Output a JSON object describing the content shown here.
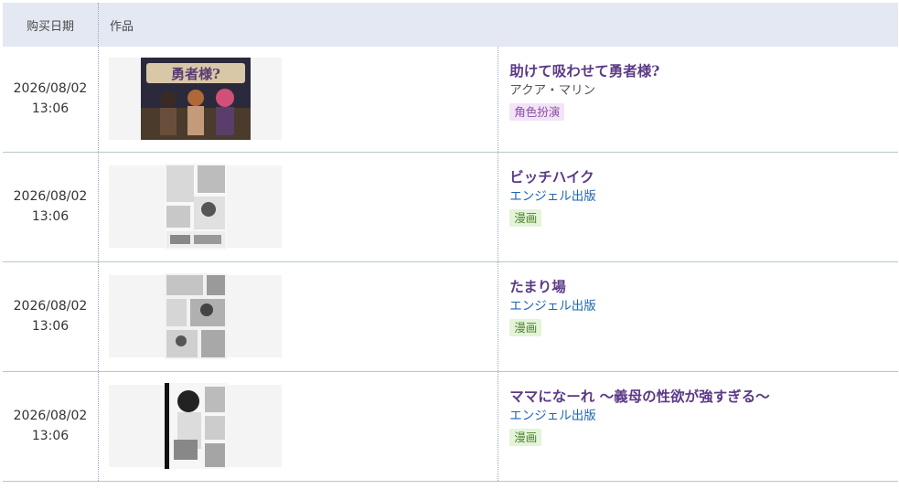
{
  "table": {
    "header": {
      "date": "购买日期",
      "work": "作品"
    },
    "rows": [
      {
        "date": "2026/08/02",
        "time": "13:06",
        "title": "助けて吸わせて勇者様?",
        "maker": "アクア・マリン",
        "genre": "角色扮演",
        "genre_type": "rp",
        "thumbnail_icon": "game-cover-icon"
      },
      {
        "date": "2026/08/02",
        "time": "13:06",
        "title": "ビッチハイク",
        "maker": "エンジェル出版",
        "genre": "漫画",
        "genre_type": "manga",
        "thumbnail_icon": "manga-cover-icon"
      },
      {
        "date": "2026/08/02",
        "time": "13:06",
        "title": "たまり場",
        "maker": "エンジェル出版",
        "genre": "漫画",
        "genre_type": "manga",
        "thumbnail_icon": "manga-cover-icon"
      },
      {
        "date": "2026/08/02",
        "time": "13:06",
        "title": "ママになーれ ～義母の性欲が強すぎる～",
        "maker": "エンジェル出版",
        "genre": "漫画",
        "genre_type": "manga",
        "thumbnail_icon": "manga-cover-icon"
      }
    ]
  },
  "colors": {
    "header_bg": "#e3e8f2",
    "title": "#5b3a87",
    "maker_link": "#1e64b4",
    "genre_rp_bg": "#f2e4f6",
    "genre_manga_bg": "#e3f4d9"
  }
}
